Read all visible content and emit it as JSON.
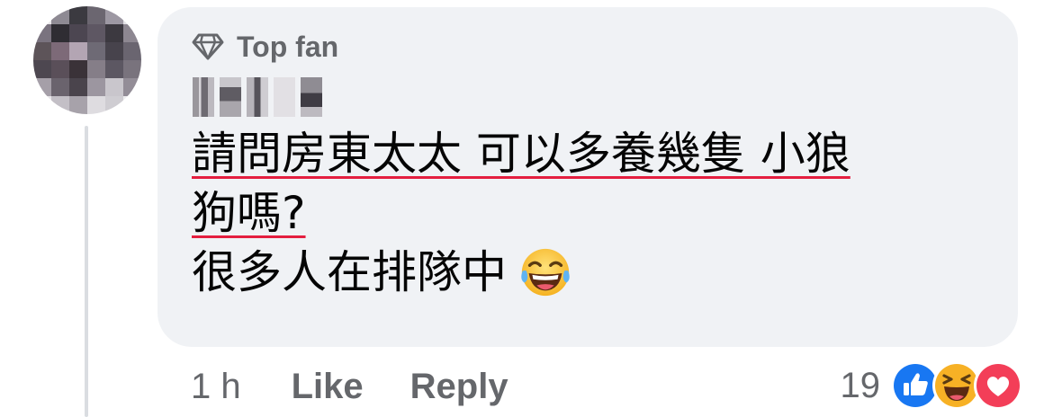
{
  "comment": {
    "badge_icon": "diamond-icon",
    "badge_label": "Top fan",
    "text_line_1": "請問房東太太 可以多養幾隻 小狼",
    "text_line_2": "狗嗎?",
    "text_line_3": "很多人在排隊中",
    "inline_emoji": "laughing-tears-emoji"
  },
  "actions": {
    "timestamp": "1 h",
    "like_label": "Like",
    "reply_label": "Reply"
  },
  "reactions": {
    "count": "19",
    "icons": [
      "like-reaction-icon",
      "haha-reaction-icon",
      "love-reaction-icon"
    ]
  },
  "colors": {
    "bubble_bg": "#f0f2f5",
    "secondary_text": "#65676b",
    "spellcheck_underline": "#e41e3f",
    "like_blue": "#1877f2",
    "love_red": "#f33e58",
    "haha_yellow": "#f7b125"
  }
}
